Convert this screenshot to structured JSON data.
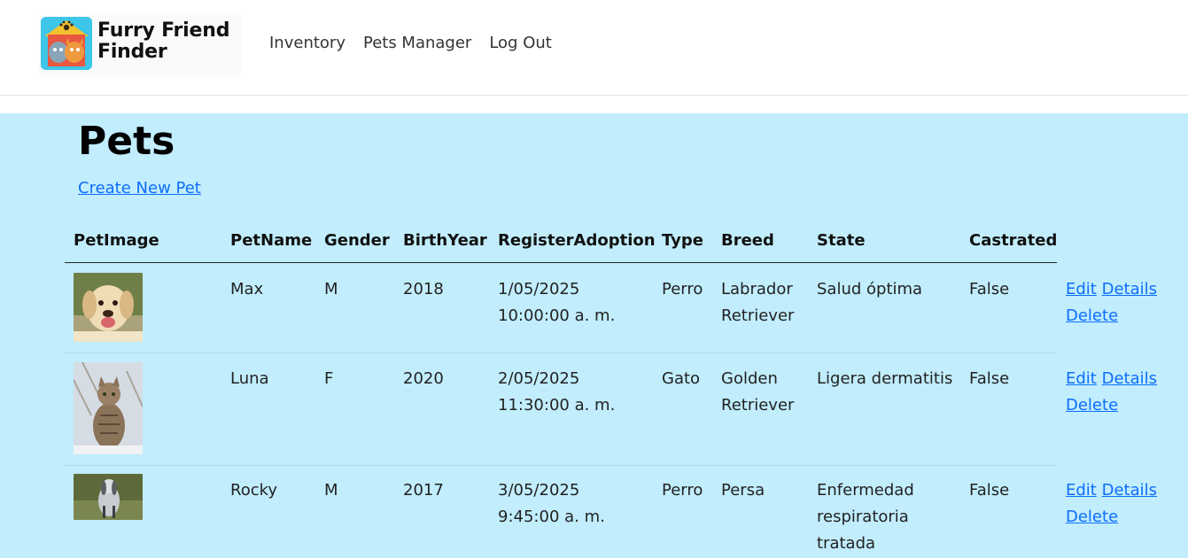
{
  "brand": {
    "name": "Furry Friend\nFinder",
    "logo_icon": "pet-house-logo-icon",
    "accent": "#3ec6e8"
  },
  "nav": {
    "items": [
      {
        "label": "Inventory"
      },
      {
        "label": "Pets Manager"
      },
      {
        "label": "Log Out"
      }
    ]
  },
  "page": {
    "title": "Pets",
    "create_label": "Create New Pet",
    "background": "#c1edfd"
  },
  "table": {
    "headers": [
      "PetImage",
      "PetName",
      "Gender",
      "BirthYear",
      "RegisterAdoption",
      "Type",
      "Breed",
      "State",
      "Castrated"
    ],
    "actions": {
      "edit": "Edit",
      "details": "Details",
      "delete": "Delete"
    },
    "rows": [
      {
        "image": "dog-photo",
        "name": "Max",
        "gender": "M",
        "birth_year": "2018",
        "register_date": "1/05/2025",
        "register_time": "10:00:00 a. m.",
        "type": "Perro",
        "breed": "Labrador Retriever",
        "state": "Salud óptima",
        "castrated": "False"
      },
      {
        "image": "cat-photo",
        "name": "Luna",
        "gender": "F",
        "birth_year": "2020",
        "register_date": "2/05/2025",
        "register_time": "11:30:00 a. m.",
        "type": "Gato",
        "breed": "Golden Retriever",
        "state": "Ligera dermatitis",
        "castrated": "False"
      },
      {
        "image": "dog-photo",
        "name": "Rocky",
        "gender": "M",
        "birth_year": "2017",
        "register_date": "3/05/2025",
        "register_time": "9:45:00 a. m.",
        "type": "Perro",
        "breed": "Persa",
        "state": "Enfermedad respiratoria tratada",
        "castrated": "False"
      }
    ]
  }
}
